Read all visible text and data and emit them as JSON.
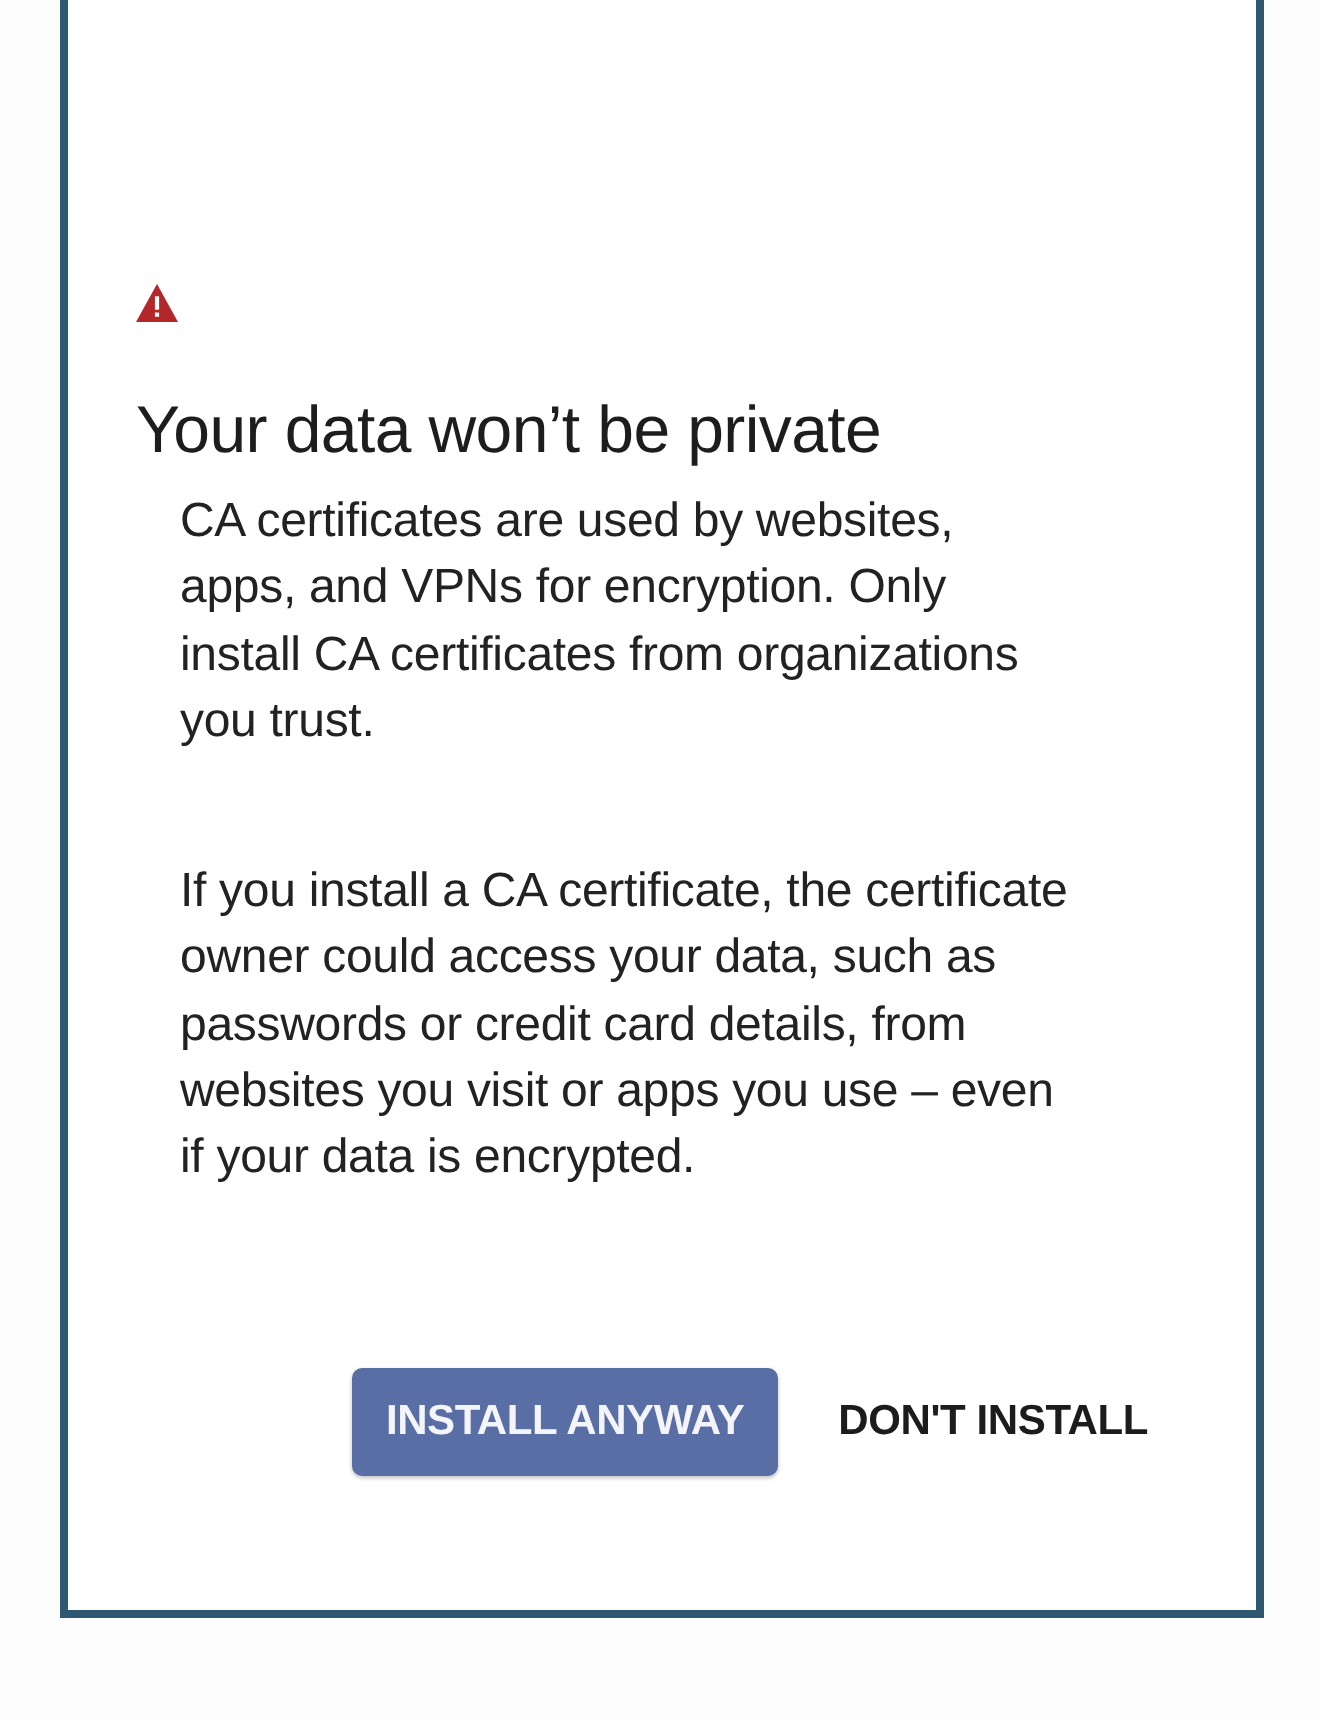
{
  "dialog": {
    "title": "Your data won’t be private",
    "paragraphs": [
      "CA certificates are used by websites, apps, and VPNs for encryption. Only install CA certificates from organizations you trust.",
      "If you install a CA certificate, the certificate owner could access your data, such as passwords or credit card details, from websites you visit or apps you use – even if your data is encrypted."
    ],
    "buttons": [
      {
        "label": "INSTALL ANYWAY",
        "kind": "filled"
      },
      {
        "label": "DON'T INSTALL",
        "kind": "text"
      }
    ]
  }
}
